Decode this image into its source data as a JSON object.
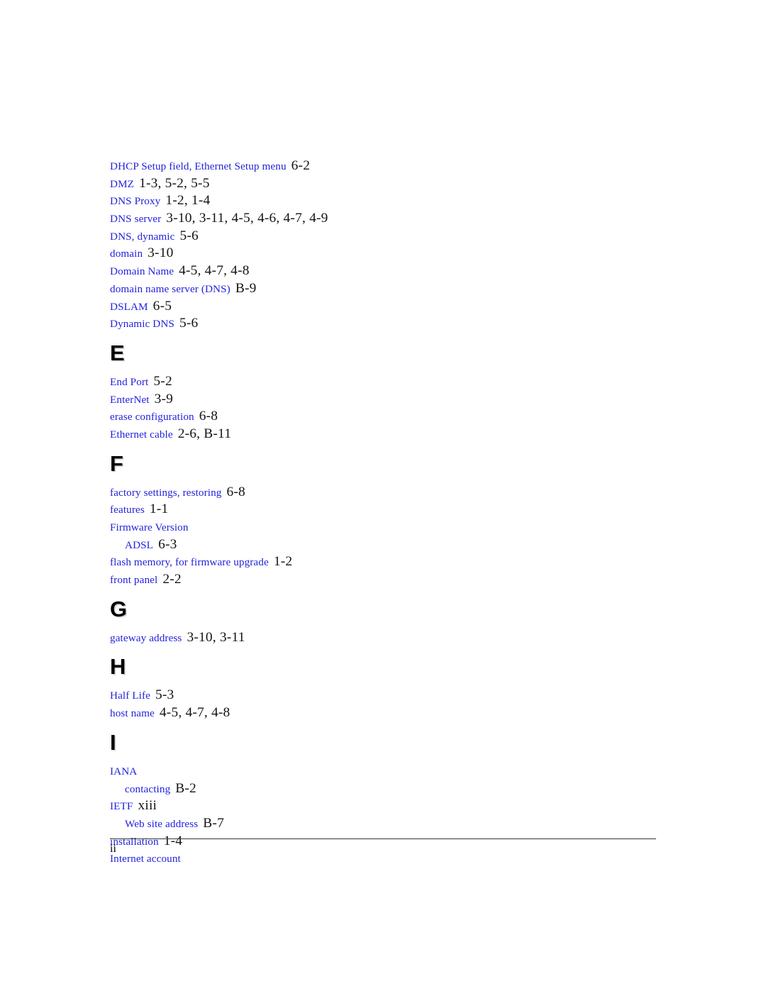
{
  "document": {
    "type": "index",
    "footer_page_number": "ii"
  },
  "colors": {
    "entry_text": "#2222dd",
    "page_reference": "#141414",
    "section_letter": "#000000",
    "section_letter_shadow": "#cfcfcf",
    "footer_rule": "#333333",
    "background": "#ffffff"
  },
  "blocks": [
    {
      "kind": "entry",
      "level": 0,
      "term": "DHCP Setup field, Ethernet Setup menu",
      "pages": "6-2"
    },
    {
      "kind": "entry",
      "level": 0,
      "term": "DMZ",
      "pages": "1-3, 5-2, 5-5"
    },
    {
      "kind": "entry",
      "level": 0,
      "term": "DNS Proxy",
      "pages": "1-2, 1-4"
    },
    {
      "kind": "entry",
      "level": 0,
      "term": "DNS server",
      "pages": "3-10, 3-11, 4-5, 4-6, 4-7, 4-9"
    },
    {
      "kind": "entry",
      "level": 0,
      "term": "DNS, dynamic",
      "pages": "5-6"
    },
    {
      "kind": "entry",
      "level": 0,
      "term": "domain",
      "pages": "3-10"
    },
    {
      "kind": "entry",
      "level": 0,
      "term": "Domain Name",
      "pages": "4-5, 4-7, 4-8"
    },
    {
      "kind": "entry",
      "level": 0,
      "term": "domain name server (DNS)",
      "pages": "B-9"
    },
    {
      "kind": "entry",
      "level": 0,
      "term": "DSLAM",
      "pages": "6-5"
    },
    {
      "kind": "entry",
      "level": 0,
      "term": "Dynamic DNS",
      "pages": "5-6"
    },
    {
      "kind": "section",
      "letter": "E"
    },
    {
      "kind": "entry",
      "level": 0,
      "term": "End Port",
      "pages": "5-2"
    },
    {
      "kind": "entry",
      "level": 0,
      "term": "EnterNet",
      "pages": "3-9"
    },
    {
      "kind": "entry",
      "level": 0,
      "term": "erase configuration",
      "pages": "6-8"
    },
    {
      "kind": "entry",
      "level": 0,
      "term": "Ethernet cable",
      "pages": "2-6, B-11"
    },
    {
      "kind": "section",
      "letter": "F"
    },
    {
      "kind": "entry",
      "level": 0,
      "term": "factory settings, restoring",
      "pages": "6-8"
    },
    {
      "kind": "entry",
      "level": 0,
      "term": "features",
      "pages": "1-1"
    },
    {
      "kind": "entry",
      "level": 0,
      "term": "Firmware Version",
      "pages": ""
    },
    {
      "kind": "entry",
      "level": 1,
      "term": "ADSL",
      "pages": "6-3"
    },
    {
      "kind": "entry",
      "level": 0,
      "term": "flash memory, for firmware upgrade",
      "pages": "1-2"
    },
    {
      "kind": "entry",
      "level": 0,
      "term": "front panel",
      "pages": "2-2"
    },
    {
      "kind": "section",
      "letter": "G"
    },
    {
      "kind": "entry",
      "level": 0,
      "term": "gateway address",
      "pages": "3-10, 3-11"
    },
    {
      "kind": "section",
      "letter": "H"
    },
    {
      "kind": "entry",
      "level": 0,
      "term": "Half Life",
      "pages": "5-3"
    },
    {
      "kind": "entry",
      "level": 0,
      "term": "host name",
      "pages": "4-5, 4-7, 4-8"
    },
    {
      "kind": "section",
      "letter": "I"
    },
    {
      "kind": "entry",
      "level": 0,
      "term": "IANA",
      "pages": ""
    },
    {
      "kind": "entry",
      "level": 1,
      "term": "contacting",
      "pages": "B-2"
    },
    {
      "kind": "entry",
      "level": 0,
      "term": "IETF",
      "pages": "xiii"
    },
    {
      "kind": "entry",
      "level": 1,
      "term": "Web site address",
      "pages": "B-7"
    },
    {
      "kind": "entry",
      "level": 0,
      "term": "installation",
      "pages": "1-4"
    },
    {
      "kind": "entry",
      "level": 0,
      "term": "Internet account",
      "pages": ""
    }
  ]
}
